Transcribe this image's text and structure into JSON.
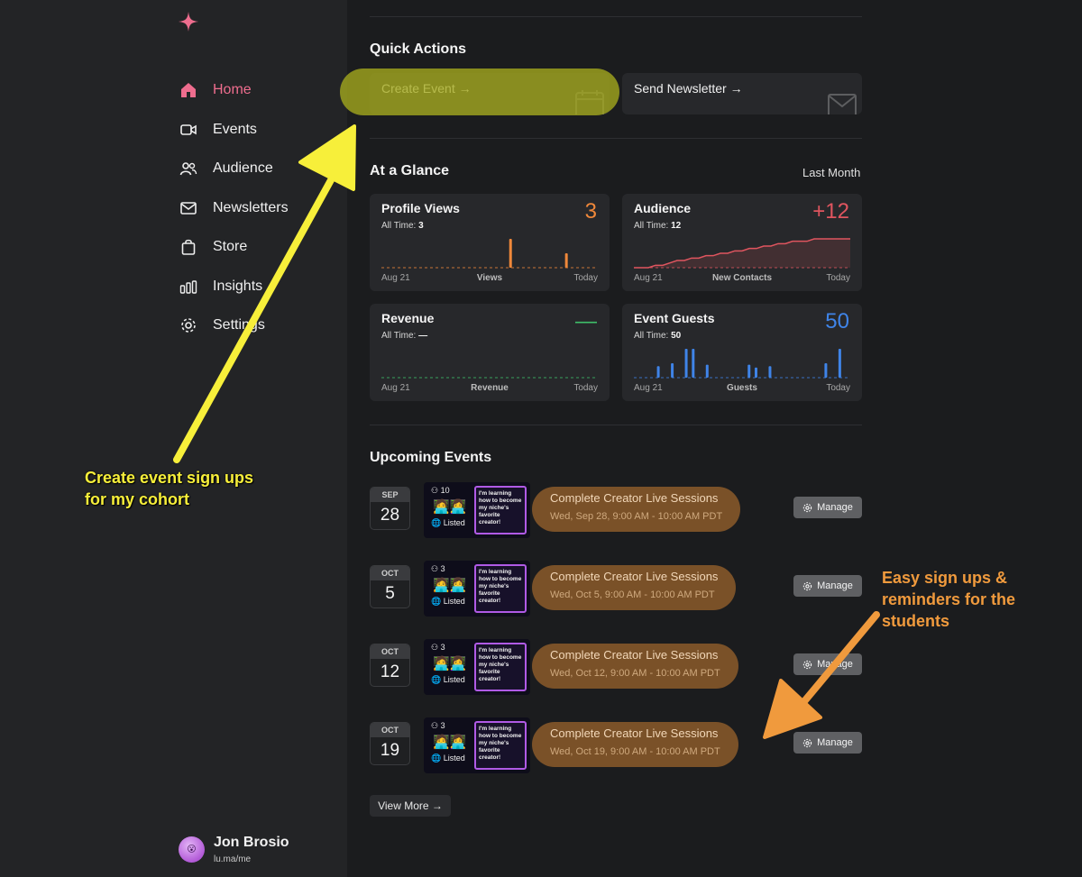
{
  "sidebar": {
    "nav": [
      {
        "label": "Home",
        "icon": "home-icon",
        "active": true
      },
      {
        "label": "Events",
        "icon": "video-icon"
      },
      {
        "label": "Audience",
        "icon": "users-icon"
      },
      {
        "label": "Newsletters",
        "icon": "mail-icon"
      },
      {
        "label": "Store",
        "icon": "bag-icon"
      },
      {
        "label": "Insights",
        "icon": "bar-chart-icon"
      },
      {
        "label": "Settings",
        "icon": "gear-icon"
      }
    ],
    "profile": {
      "name": "Jon Brosio",
      "handle": "lu.ma/me"
    }
  },
  "quick_actions": {
    "title": "Quick Actions",
    "items": [
      {
        "label": "Create Event →",
        "icon": "calendar-icon"
      },
      {
        "label": "Send Newsletter →",
        "icon": "mail-icon"
      }
    ]
  },
  "glance": {
    "title": "At a Glance",
    "range": "Last Month",
    "cards": [
      {
        "title": "Profile Views",
        "sub_label": "All Time:",
        "sub_value": "3",
        "value": "3",
        "value_color": "#f0883a",
        "start": "Aug 21",
        "metric": "Views",
        "end": "Today",
        "chart": "bars",
        "color": "#f0883a",
        "values": [
          0,
          0,
          0,
          0,
          0,
          0,
          0,
          0,
          0,
          0,
          0,
          0,
          0,
          0,
          0,
          0,
          0,
          0,
          1,
          0,
          0,
          0,
          0,
          0,
          0,
          0,
          0.5,
          0,
          0,
          0,
          0
        ]
      },
      {
        "title": "Audience",
        "sub_label": "All Time:",
        "sub_value": "12",
        "value": "+12",
        "value_color": "#e0555f",
        "start": "Aug 21",
        "metric": "New Contacts",
        "end": "Today",
        "chart": "line",
        "color": "#e0555f",
        "values": [
          0,
          0,
          0,
          1,
          1,
          2,
          3,
          3,
          4,
          4,
          5,
          5,
          6,
          6,
          7,
          7,
          8,
          8,
          9,
          9,
          10,
          10,
          11,
          11,
          11,
          12,
          12,
          12,
          12,
          12,
          12
        ]
      },
      {
        "title": "Revenue",
        "sub_label": "All Time:",
        "sub_value": "—",
        "value": "—",
        "value_color": "#3fbf6a",
        "start": "Aug 21",
        "metric": "Revenue",
        "end": "Today",
        "chart": "flat",
        "color": "#3fbf6a",
        "values": []
      },
      {
        "title": "Event Guests",
        "sub_label": "All Time:",
        "sub_value": "50",
        "value": "50",
        "value_color": "#3f84e8",
        "start": "Aug 21",
        "metric": "Guests",
        "end": "Today",
        "chart": "bars",
        "color": "#3f84e8",
        "values": [
          0,
          0,
          0,
          0.4,
          0,
          0.5,
          0,
          1,
          1,
          0,
          0.45,
          0,
          0,
          0,
          0,
          0,
          0.45,
          0.35,
          0,
          0.4,
          0,
          0,
          0,
          0,
          0,
          0,
          0,
          0.5,
          0,
          1,
          0
        ]
      }
    ]
  },
  "events": {
    "title": "Upcoming Events",
    "items": [
      {
        "month": "SEP",
        "day": "28",
        "guests": "10",
        "listed": "Listed",
        "thumb_text": "I'm learning how to become my niche's favorite creator!",
        "title": "Complete Creator Live Sessions",
        "time": "Wed, Sep 28, 9:00 AM - 10:00 AM PDT",
        "manage": "Manage"
      },
      {
        "month": "OCT",
        "day": "5",
        "guests": "3",
        "listed": "Listed",
        "thumb_text": "I'm learning how to become my niche's favorite creator!",
        "title": "Complete Creator Live Sessions",
        "time": "Wed, Oct 5, 9:00 AM - 10:00 AM PDT",
        "manage": "Manage"
      },
      {
        "month": "OCT",
        "day": "12",
        "guests": "3",
        "listed": "Listed",
        "thumb_text": "I'm learning how to become my niche's favorite creator!",
        "title": "Complete Creator Live Sessions",
        "time": "Wed, Oct 12, 9:00 AM - 10:00 AM PDT",
        "manage": "Manage"
      },
      {
        "month": "OCT",
        "day": "19",
        "guests": "3",
        "listed": "Listed",
        "thumb_text": "I'm learning how to become my niche's favorite creator!",
        "title": "Complete Creator Live Sessions",
        "time": "Wed, Oct 19, 9:00 AM - 10:00 AM PDT",
        "manage": "Manage"
      }
    ],
    "view_more": "View More →"
  },
  "annotations": {
    "yellow": "Create event sign ups for my cohort",
    "orange": "Easy sign ups & reminders for the students"
  },
  "colors": {
    "accent": "#ee6d8e",
    "highlight": "#a5aa1e",
    "arrow_yellow": "#f7ef3a",
    "arrow_orange": "#f09a3d"
  }
}
